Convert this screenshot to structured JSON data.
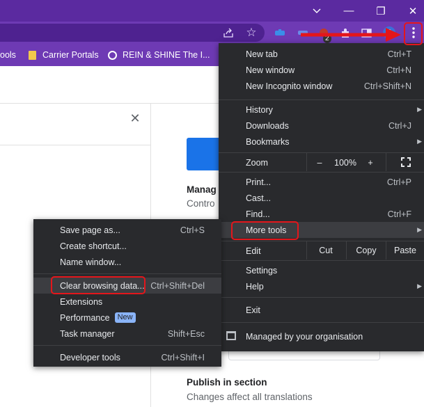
{
  "window": {
    "minimize_icon": "chevron-down-icon",
    "buttons": [
      "—",
      "❐",
      "✕"
    ]
  },
  "toolbar": {
    "extension_badge": "2"
  },
  "bookmarks": {
    "items": [
      {
        "label": "ools",
        "icon": "none"
      },
      {
        "label": "Carrier Portals",
        "icon": "folder-icon"
      },
      {
        "label": "REIN & SHINE The I...",
        "icon": "globe-icon"
      }
    ]
  },
  "page": {
    "section_heading": "Manag",
    "section_sub": "Contro",
    "publish_heading": "Publish in section",
    "publish_sub": "Changes affect all translations"
  },
  "main_menu": {
    "new_tab": "New tab",
    "new_tab_sc": "Ctrl+T",
    "new_window": "New window",
    "new_window_sc": "Ctrl+N",
    "new_incognito": "New Incognito window",
    "new_incognito_sc": "Ctrl+Shift+N",
    "history": "History",
    "downloads": "Downloads",
    "downloads_sc": "Ctrl+J",
    "bookmarks": "Bookmarks",
    "zoom": "Zoom",
    "zoom_minus": "–",
    "zoom_value": "100%",
    "zoom_plus": "+",
    "print": "Print...",
    "print_sc": "Ctrl+P",
    "cast": "Cast...",
    "find": "Find...",
    "find_sc": "Ctrl+F",
    "more_tools": "More tools",
    "edit": "Edit",
    "cut": "Cut",
    "copy": "Copy",
    "paste": "Paste",
    "settings": "Settings",
    "help": "Help",
    "exit": "Exit",
    "managed": "Managed by your organisation"
  },
  "sub_menu": {
    "save_page": "Save page as...",
    "save_page_sc": "Ctrl+S",
    "create_shortcut": "Create shortcut...",
    "name_window": "Name window...",
    "clear_data": "Clear browsing data...",
    "clear_data_sc": "Ctrl+Shift+Del",
    "extensions": "Extensions",
    "performance": "Performance",
    "performance_badge": "New",
    "task_manager": "Task manager",
    "task_manager_sc": "Shift+Esc",
    "developer_tools": "Developer tools",
    "developer_tools_sc": "Ctrl+Shift+I"
  },
  "colors": {
    "titlebar": "#5b2aa0",
    "toolbar": "#6e3ab4",
    "menu_bg": "#292a2d",
    "annotation": "#e4161b",
    "accent_blue": "#1a73e8"
  }
}
